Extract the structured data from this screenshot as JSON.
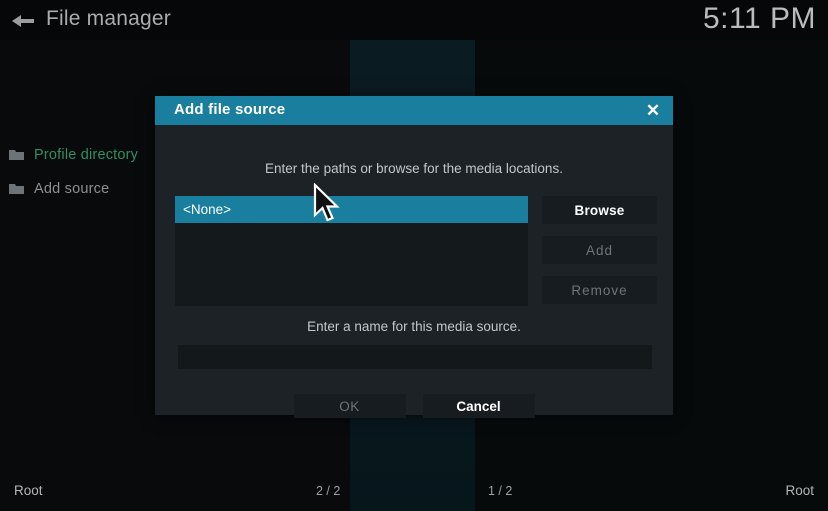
{
  "header": {
    "back_icon": "back-arrow-icon",
    "title": "File manager",
    "clock": "5:11 PM"
  },
  "sidebar": {
    "items": [
      {
        "label": "Profile directory",
        "icon": "folder-icon",
        "active": true
      },
      {
        "label": "Add source",
        "icon": "folder-icon",
        "active": false
      }
    ]
  },
  "bottom_bar": {
    "left_path": "Root",
    "left_count": "2 / 2",
    "right_count": "1 / 2",
    "right_path": "Root"
  },
  "dialog": {
    "title": "Add file source",
    "close_icon": "close-icon",
    "instruction": "Enter the paths or browse for the media locations.",
    "path_list": [
      {
        "label": "<None>",
        "selected": true
      }
    ],
    "side_buttons": [
      {
        "label": "Browse",
        "enabled": true
      },
      {
        "label": "Add",
        "enabled": false
      },
      {
        "label": "Remove",
        "enabled": false
      }
    ],
    "name_label": "Enter a name for this media source.",
    "name_value": "",
    "name_placeholder": "",
    "footer_buttons": [
      {
        "label": "OK",
        "enabled": false
      },
      {
        "label": "Cancel",
        "enabled": true
      }
    ]
  },
  "colors": {
    "accent_teal": "#1a7f9e",
    "dialog_bg": "#1c2226",
    "active_green": "#2f8f62",
    "background": "#070a0b"
  }
}
